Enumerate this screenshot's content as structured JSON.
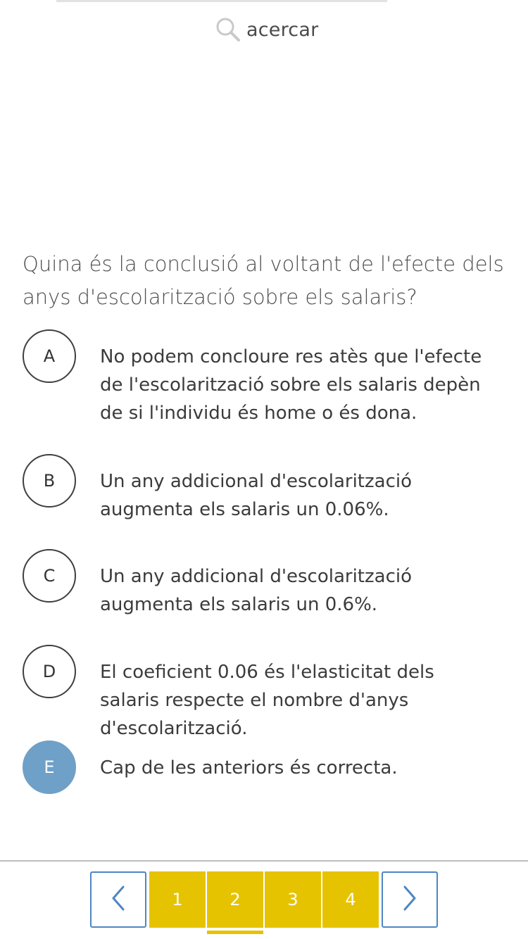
{
  "zoom": {
    "label": "acercar",
    "icon": "search-icon"
  },
  "question": {
    "text": "Quina és la conclusió al voltant de l'efecte dels anys d'escolarització sobre els salaris?"
  },
  "options": [
    {
      "letter": "A",
      "text": "No podem concloure res atès que l'efecte de l'escolarització sobre els salaris depèn de si l'individu és home o és dona.",
      "selected": false
    },
    {
      "letter": "B",
      "text": "Un any addicional d'escolarització augmenta els salaris un 0.06%.",
      "selected": false
    },
    {
      "letter": "C",
      "text": "Un any addicional d'escolarització augmenta els salaris un 0.6%.",
      "selected": false
    },
    {
      "letter": "D",
      "text": "El coeficient 0.06 és l'elasticitat dels salaris respecte el nombre d'anys d'escolarització.",
      "selected": false
    },
    {
      "letter": "E",
      "text": "Cap de les anteriors és correcta.",
      "selected": true
    }
  ],
  "pagination": {
    "prev_icon": "chevron-left-icon",
    "next_icon": "chevron-right-icon",
    "pages": [
      "1",
      "2",
      "3",
      "4"
    ],
    "current_page": "2"
  },
  "colors": {
    "selected_option": "#6fa0c7",
    "page_button": "#e6c300",
    "nav_border": "#4d86c2",
    "text": "#3b3b3b"
  }
}
